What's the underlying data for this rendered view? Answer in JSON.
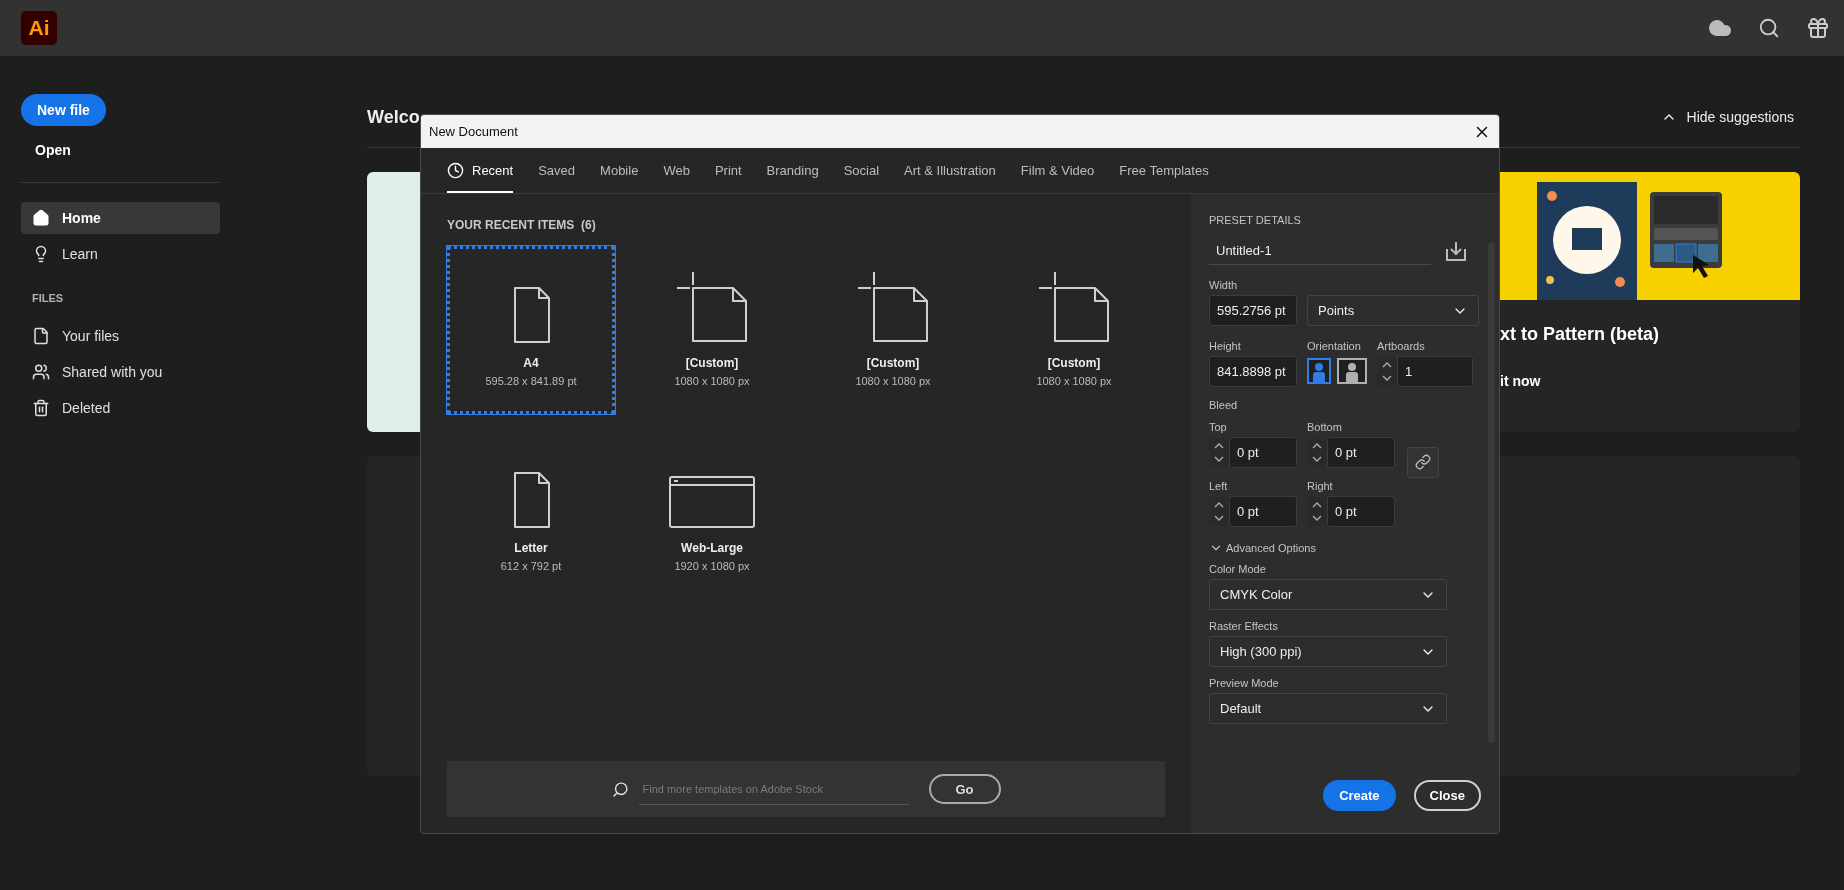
{
  "app_bar": {
    "logo": "Ai"
  },
  "sidebar": {
    "new_file": "New file",
    "open": "Open",
    "nav": [
      {
        "label": "Home",
        "selected": true,
        "kind": "home"
      },
      {
        "label": "Learn",
        "selected": false,
        "kind": "bulb"
      }
    ],
    "files_heading": "FILES",
    "files": [
      {
        "label": "Your files",
        "kind": "file"
      },
      {
        "label": "Shared with you",
        "kind": "people"
      },
      {
        "label": "Deleted",
        "kind": "trash"
      }
    ]
  },
  "main": {
    "welcome": "Welco",
    "hide_suggestions": "Hide suggestions",
    "feature": {
      "kind": "picture",
      "title": "xt to Pattern (beta)",
      "action": "it now"
    }
  },
  "dialog": {
    "title": "New Document",
    "tabs": [
      {
        "label": "Recent",
        "selected": true,
        "kind": "clock"
      },
      {
        "label": "Saved",
        "selected": false
      },
      {
        "label": "Mobile",
        "selected": false
      },
      {
        "label": "Web",
        "selected": false
      },
      {
        "label": "Print",
        "selected": false
      },
      {
        "label": "Branding",
        "selected": false
      },
      {
        "label": "Social",
        "selected": false
      },
      {
        "label": "Art & Illustration",
        "selected": false
      },
      {
        "label": "Film & Video",
        "selected": false
      },
      {
        "label": "Free Templates",
        "selected": false
      }
    ],
    "recent_heading": "YOUR RECENT ITEMS",
    "recent_count": "(6)",
    "items": [
      {
        "name": "A4",
        "size": "595.28 x 841.89 pt",
        "kind": "page",
        "selected": true
      },
      {
        "name": "[Custom]",
        "size": "1080 x 1080 px",
        "kind": "custom",
        "selected": false
      },
      {
        "name": "[Custom]",
        "size": "1080 x 1080 px",
        "kind": "custom",
        "selected": false
      },
      {
        "name": "[Custom]",
        "size": "1080 x 1080 px",
        "kind": "custom",
        "selected": false
      },
      {
        "name": "Letter",
        "size": "612 x 792 pt",
        "kind": "page",
        "selected": false
      },
      {
        "name": "Web-Large",
        "size": "1920 x 1080 px",
        "kind": "web",
        "selected": false
      }
    ],
    "search": {
      "placeholder": "Find more templates on Adobe Stock",
      "go": "Go"
    },
    "preset": {
      "heading": "PRESET DETAILS",
      "name": "Untitled-1",
      "width": {
        "label": "Width",
        "value": "595.2756 pt"
      },
      "units": "Points",
      "height": {
        "label": "Height",
        "value": "841.8898 pt"
      },
      "orientation": {
        "label": "Orientation",
        "options": [
          {
            "kind": "portrait",
            "selected": true
          },
          {
            "kind": "landscape",
            "selected": false
          }
        ]
      },
      "artboards": {
        "label": "Artboards",
        "value": "1"
      },
      "bleed": {
        "label": "Bleed",
        "fields": [
          {
            "label": "Top",
            "value": "0 pt"
          },
          {
            "label": "Bottom",
            "value": "0 pt"
          },
          {
            "label": "Left",
            "value": "0 pt"
          },
          {
            "label": "Right",
            "value": "0 pt"
          }
        ]
      },
      "advanced": {
        "label": "Advanced Options",
        "expanded": true
      },
      "selects": [
        {
          "label": "Color Mode",
          "value": "CMYK Color"
        },
        {
          "label": "Raster Effects",
          "value": "High (300 ppi)"
        },
        {
          "label": "Preview Mode",
          "value": "Default"
        }
      ]
    },
    "buttons": {
      "create": "Create",
      "close": "Close"
    }
  }
}
